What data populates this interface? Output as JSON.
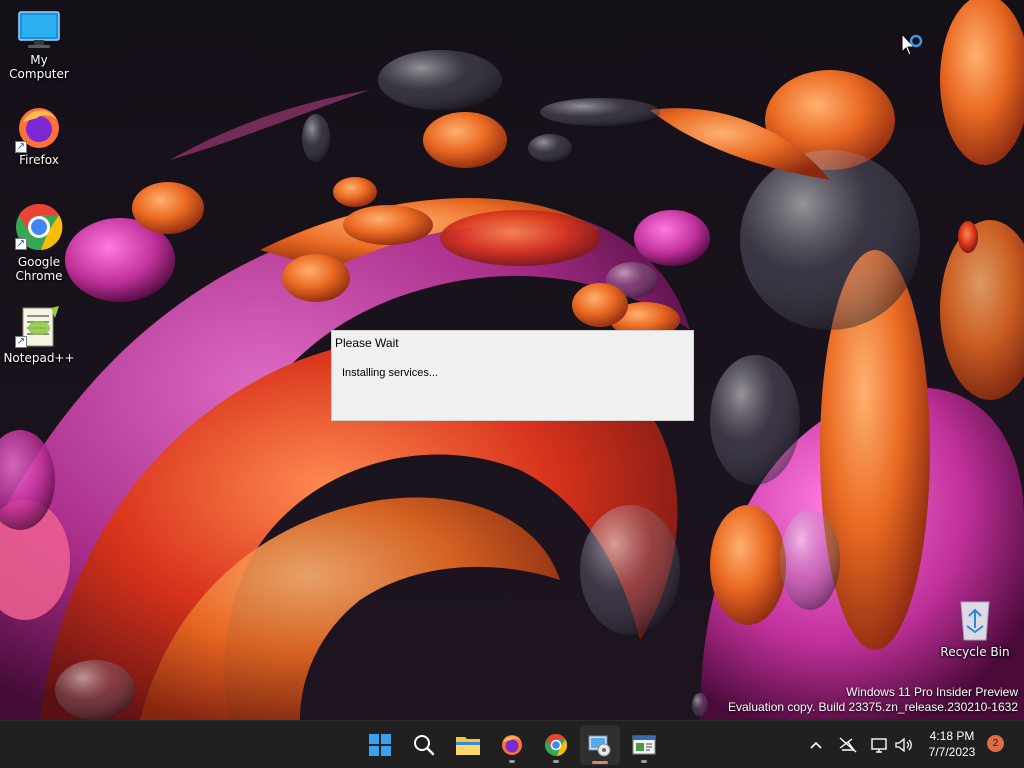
{
  "desktop": {
    "icons": [
      {
        "label": "My Computer"
      },
      {
        "label": "Firefox"
      },
      {
        "label": "Google Chrome"
      },
      {
        "label": "Notepad++"
      }
    ],
    "recycle_bin": {
      "label": "Recycle Bin"
    }
  },
  "dialog": {
    "title": "Please Wait",
    "message": "Installing services..."
  },
  "watermark": {
    "line1": "Windows 11 Pro Insider Preview",
    "line2": "Evaluation copy. Build 23375.zn_release.230210-1632"
  },
  "taskbar": {
    "apps": [
      "start-icon",
      "search-icon",
      "file-explorer-icon",
      "firefox-icon",
      "chrome-icon",
      "installer-icon",
      "console-app-icon"
    ],
    "tray": [
      "show-hidden-icons-chevron",
      "network-disconnected-icon",
      "display-icon",
      "volume-icon"
    ],
    "clock": {
      "time": "4:18 PM",
      "date": "7/7/2023"
    },
    "notification_count": "2"
  },
  "colors": {
    "taskbar_bg": "#202020",
    "dialog_bg": "#f0f0f0",
    "accent_orange": "#e06c47",
    "start_blue": "#3aa0f0"
  }
}
